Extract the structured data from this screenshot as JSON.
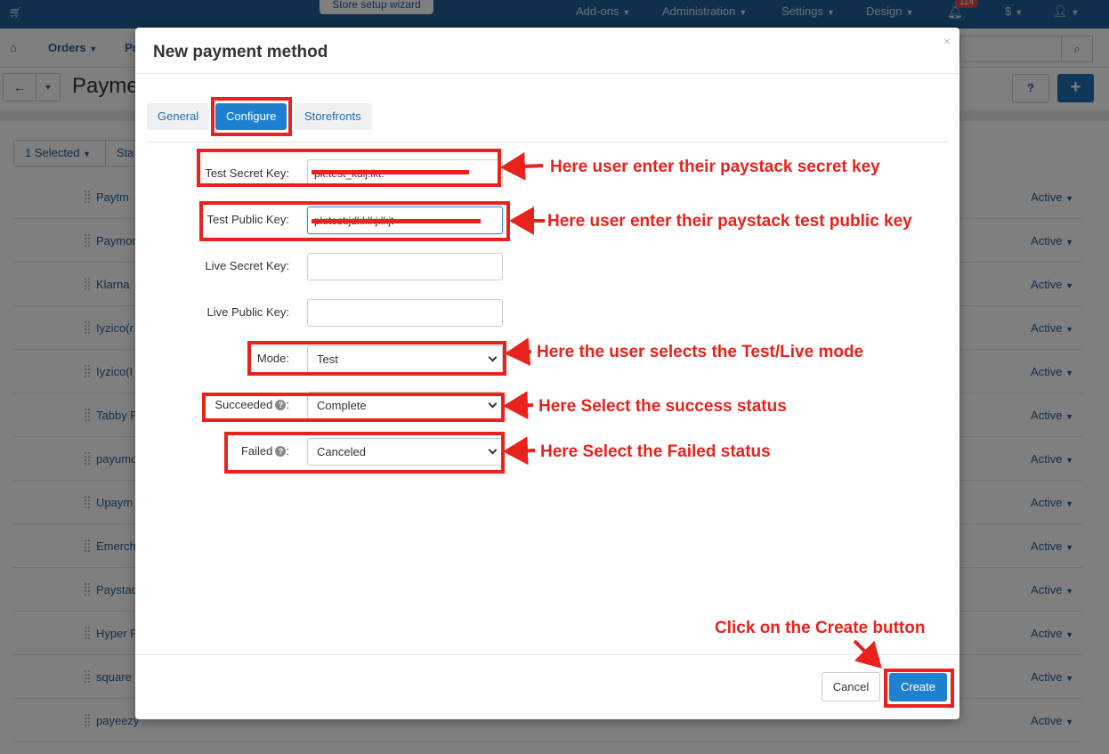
{
  "topbar": {
    "wizard_label": "Store setup wizard",
    "nav": [
      "Add-ons",
      "Administration",
      "Settings",
      "Design"
    ],
    "notification_count": "114",
    "currency": "$"
  },
  "navbar": {
    "items": [
      "Orders",
      "Pr"
    ]
  },
  "page": {
    "title": "Payme"
  },
  "bulk": {
    "selected_label": "1 Selected",
    "status_label": "Sta"
  },
  "background_rows": [
    {
      "name": "Paytm",
      "status": "Active"
    },
    {
      "name": "Paymor",
      "status": "Active"
    },
    {
      "name": "Klarna",
      "status": "Active"
    },
    {
      "name": "Iyzico(r",
      "status": "Active"
    },
    {
      "name": "Iyzico(I",
      "status": "Active"
    },
    {
      "name": "Tabby P",
      "status": "Active"
    },
    {
      "name": "payumo",
      "status": "Active"
    },
    {
      "name": "Upaym",
      "status": "Active"
    },
    {
      "name": "Emerch",
      "status": "Active"
    },
    {
      "name": "Paystac",
      "status": "Active"
    },
    {
      "name": "Hyper P",
      "status": "Active"
    },
    {
      "name": "square",
      "status": "Active"
    },
    {
      "name": "payeezy",
      "status": "Active"
    }
  ],
  "modal": {
    "title": "New payment method",
    "close_glyph": "×",
    "tabs": [
      {
        "label": "General",
        "active": false
      },
      {
        "label": "Configure",
        "active": true
      },
      {
        "label": "Storefronts",
        "active": false
      }
    ],
    "fields": {
      "test_secret_key": {
        "label": "Test Secret Key:",
        "value": "pk:test_kdlj:lkt:"
      },
      "test_public_key": {
        "label": "Test Public Key:",
        "value": "pk:test:jdkl:lkj:lkjt"
      },
      "live_secret_key": {
        "label": "Live Secret Key:",
        "value": ""
      },
      "live_public_key": {
        "label": "Live Public Key:",
        "value": ""
      },
      "mode": {
        "label": "Mode:",
        "selected": "Test"
      },
      "succeeded": {
        "label": "Succeeded",
        "selected": "Complete"
      },
      "failed": {
        "label": "Failed",
        "selected": "Canceled"
      }
    },
    "buttons": {
      "cancel": "Cancel",
      "create": "Create"
    }
  },
  "annotations": {
    "secret_key_note": "Here user enter their paystack secret key",
    "public_key_note": "Here user enter their paystack test public key",
    "mode_note": "Here the user selects the Test/Live mode",
    "success_note": "Here Select the success status",
    "failed_note": "Here Select the Failed status",
    "create_note": "Click on the Create button",
    "color": "#e8221c"
  },
  "colors": {
    "topbar": "#1e5f99",
    "primary_button": "#1e80d0",
    "link": "#1e5f99"
  }
}
